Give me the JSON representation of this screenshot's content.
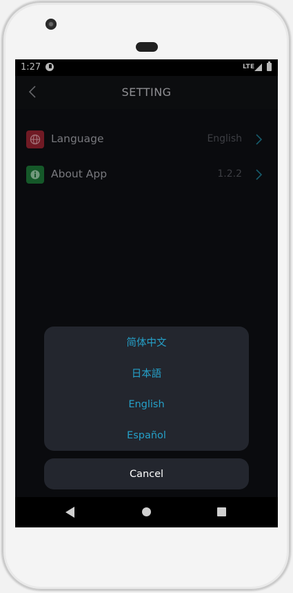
{
  "status_bar": {
    "time": "1:27",
    "network": "LTE"
  },
  "header": {
    "title": "SETTING"
  },
  "settings": [
    {
      "label": "Language",
      "value": "English",
      "icon": "globe-icon"
    },
    {
      "label": "About App",
      "value": "1.2.2",
      "icon": "info-icon"
    }
  ],
  "language_sheet": {
    "options": [
      "简体中文",
      "日本語",
      "English",
      "Español"
    ],
    "cancel_label": "Cancel"
  },
  "colors": {
    "background": "#0f1014",
    "accent": "#25a0c8",
    "sheet": "#23262e",
    "language_icon": "#9b2432",
    "about_icon": "#1e7a3a"
  }
}
